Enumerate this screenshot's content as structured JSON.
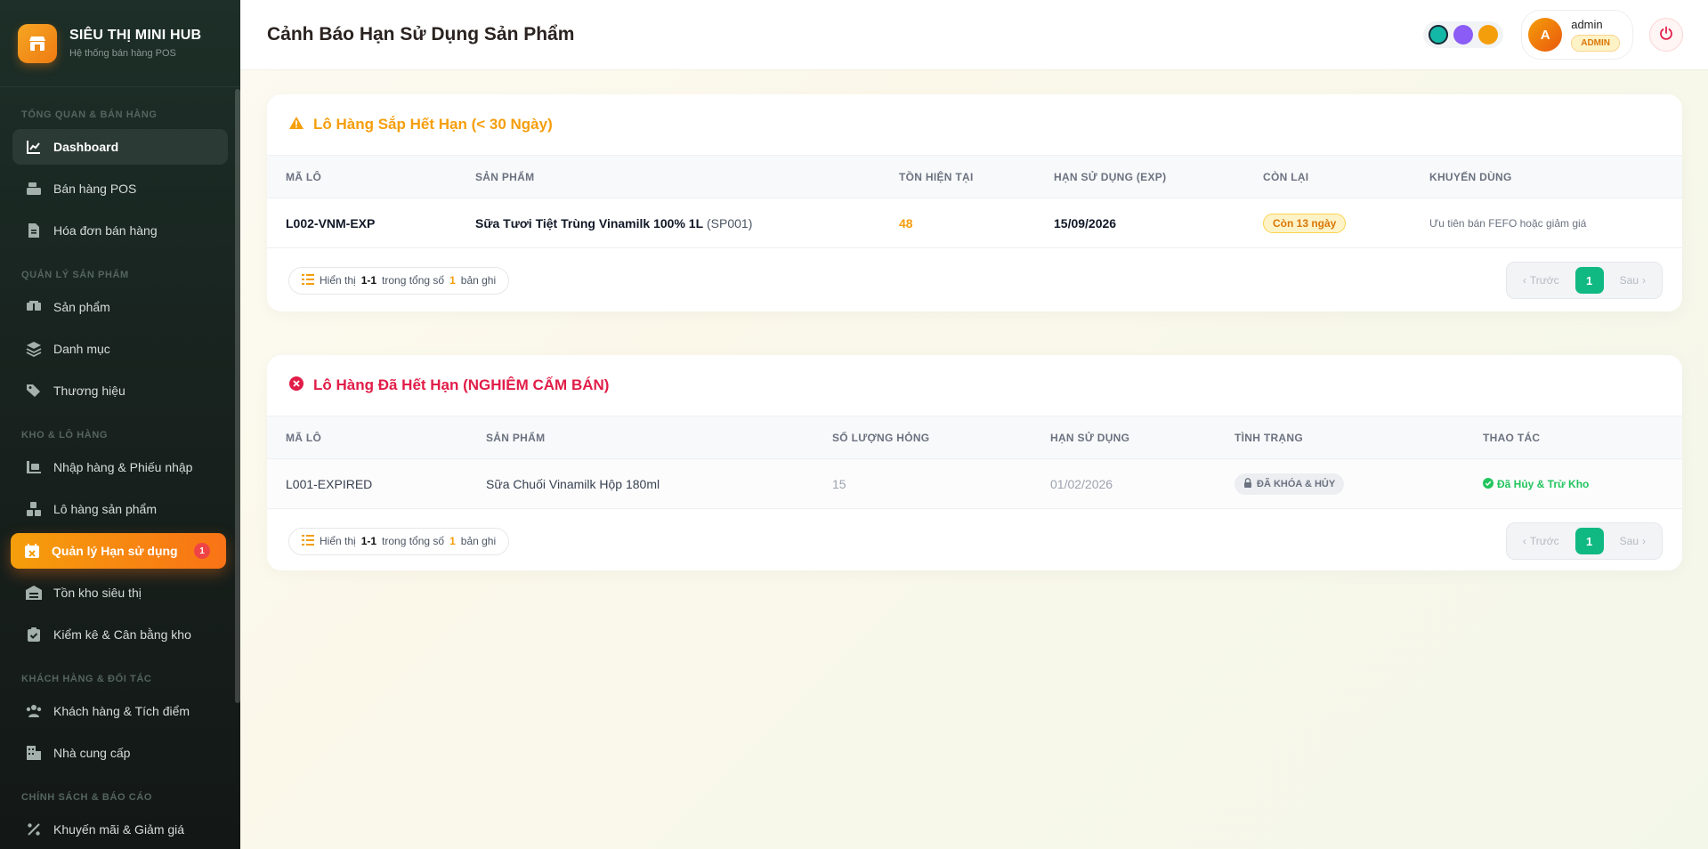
{
  "brand": {
    "title": "SIÊU THỊ MINI HUB",
    "subtitle": "Hệ thống bán hàng POS"
  },
  "sidebar": {
    "sections": [
      {
        "label": "TỔNG QUAN & BÁN HÀNG",
        "items": [
          {
            "label": "Dashboard",
            "icon": "chart-line-icon"
          },
          {
            "label": "Bán hàng POS",
            "icon": "cash-register-icon"
          },
          {
            "label": "Hóa đơn bán hàng",
            "icon": "invoice-icon"
          }
        ]
      },
      {
        "label": "QUẢN LÝ SẢN PHẨM",
        "items": [
          {
            "label": "Sản phẩm",
            "icon": "boxes-icon"
          },
          {
            "label": "Danh mục",
            "icon": "layers-icon"
          },
          {
            "label": "Thương hiệu",
            "icon": "tags-icon"
          }
        ]
      },
      {
        "label": "KHO & LÔ HÀNG",
        "items": [
          {
            "label": "Nhập hàng & Phiếu nhập",
            "icon": "truck-loading-icon"
          },
          {
            "label": "Lô hàng sản phẩm",
            "icon": "cubes-icon"
          },
          {
            "label": "Quản lý Hạn sử dụng",
            "icon": "calendar-x-icon",
            "badge": "1"
          },
          {
            "label": "Tồn kho siêu thị",
            "icon": "warehouse-icon"
          },
          {
            "label": "Kiểm kê & Cân bằng kho",
            "icon": "clipboard-check-icon"
          }
        ]
      },
      {
        "label": "KHÁCH HÀNG & ĐỐI TÁC",
        "items": [
          {
            "label": "Khách hàng & Tích điểm",
            "icon": "users-icon"
          },
          {
            "label": "Nhà cung cấp",
            "icon": "building-icon"
          }
        ]
      },
      {
        "label": "CHÍNH SÁCH & BÁO CÁO",
        "items": [
          {
            "label": "Khuyến mãi & Giảm giá",
            "icon": "percent-icon"
          }
        ]
      }
    ]
  },
  "header": {
    "title": "Cảnh Báo Hạn Sử Dụng Sản Phẩm",
    "theme_colors": [
      "#14b8a6",
      "#8b5cf6",
      "#f59e0b"
    ],
    "user": {
      "initial": "A",
      "name": "admin",
      "role": "ADMIN"
    }
  },
  "expiring": {
    "title": "Lô Hàng Sắp Hết Hạn (< 30 Ngày)",
    "columns": [
      "MÃ LÔ",
      "SẢN PHẨM",
      "TỒN HIỆN TẠI",
      "HẠN SỬ DỤNG (EXP)",
      "CÒN LẠI",
      "KHUYẾN DÙNG"
    ],
    "rows": [
      {
        "lot": "L002-VNM-EXP",
        "product": "Sữa Tươi Tiệt Trùng Vinamilk 100% 1L",
        "code": "(SP001)",
        "stock": "48",
        "exp": "15/09/2026",
        "remaining": "Còn 13 ngày",
        "suggest": "Ưu tiên bán FEFO hoặc giảm giá"
      }
    ],
    "footer": {
      "show": "Hiển thị",
      "range": "1-1",
      "of": "trong tổng số",
      "total": "1",
      "unit": "bản ghi"
    },
    "pager": {
      "prev": "Trước",
      "current": "1",
      "next": "Sau"
    }
  },
  "expired": {
    "title": "Lô Hàng Đã Hết Hạn (NGHIÊM CẤM BÁN)",
    "columns": [
      "MÃ LÔ",
      "SẢN PHẨM",
      "SỐ LƯỢNG HỎNG",
      "HẠN SỬ DỤNG",
      "TÌNH TRẠNG",
      "THAO TÁC"
    ],
    "rows": [
      {
        "lot": "L001-EXPIRED",
        "product": "Sữa Chuối Vinamilk Hộp 180ml",
        "damaged": "15",
        "exp": "01/02/2026",
        "status": "ĐÃ KHÓA & HỦY",
        "action": "Đã Hủy & Trừ Kho"
      }
    ],
    "footer": {
      "show": "Hiển thị",
      "range": "1-1",
      "of": "trong tổng số",
      "total": "1",
      "unit": "bản ghi"
    },
    "pager": {
      "prev": "Trước",
      "current": "1",
      "next": "Sau"
    }
  }
}
